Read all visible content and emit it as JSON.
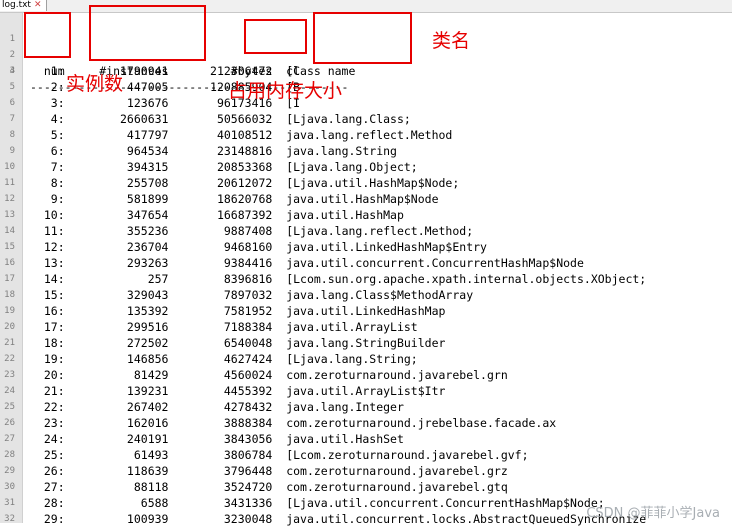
{
  "tab": {
    "filename": "log.txt",
    "close_glyph": "✕"
  },
  "header": {
    "text": "  num     #instances         #bytes  class name"
  },
  "separator": {
    "text": "----------------------------------------------"
  },
  "table": {
    "rows": [
      {
        "num": "1:",
        "instances": "1790941",
        "bytes": "212306472",
        "cls": "[C"
      },
      {
        "num": "2:",
        "instances": "447005",
        "bytes": "120885904",
        "cls": "[B"
      },
      {
        "num": "3:",
        "instances": "123676",
        "bytes": "96173416",
        "cls": "[I"
      },
      {
        "num": "4:",
        "instances": "2660631",
        "bytes": "50566032",
        "cls": "[Ljava.lang.Class;"
      },
      {
        "num": "5:",
        "instances": "417797",
        "bytes": "40108512",
        "cls": "java.lang.reflect.Method"
      },
      {
        "num": "6:",
        "instances": "964534",
        "bytes": "23148816",
        "cls": "java.lang.String"
      },
      {
        "num": "7:",
        "instances": "394315",
        "bytes": "20853368",
        "cls": "[Ljava.lang.Object;"
      },
      {
        "num": "8:",
        "instances": "255708",
        "bytes": "20612072",
        "cls": "[Ljava.util.HashMap$Node;"
      },
      {
        "num": "9:",
        "instances": "581899",
        "bytes": "18620768",
        "cls": "java.util.HashMap$Node"
      },
      {
        "num": "10:",
        "instances": "347654",
        "bytes": "16687392",
        "cls": "java.util.HashMap"
      },
      {
        "num": "11:",
        "instances": "355236",
        "bytes": "9887408",
        "cls": "[Ljava.lang.reflect.Method;"
      },
      {
        "num": "12:",
        "instances": "236704",
        "bytes": "9468160",
        "cls": "java.util.LinkedHashMap$Entry"
      },
      {
        "num": "13:",
        "instances": "293263",
        "bytes": "9384416",
        "cls": "java.util.concurrent.ConcurrentHashMap$Node"
      },
      {
        "num": "14:",
        "instances": "257",
        "bytes": "8396816",
        "cls": "[Lcom.sun.org.apache.xpath.internal.objects.XObject;"
      },
      {
        "num": "15:",
        "instances": "329043",
        "bytes": "7897032",
        "cls": "java.lang.Class$MethodArray"
      },
      {
        "num": "16:",
        "instances": "135392",
        "bytes": "7581952",
        "cls": "java.util.LinkedHashMap"
      },
      {
        "num": "17:",
        "instances": "299516",
        "bytes": "7188384",
        "cls": "java.util.ArrayList"
      },
      {
        "num": "18:",
        "instances": "272502",
        "bytes": "6540048",
        "cls": "java.lang.StringBuilder"
      },
      {
        "num": "19:",
        "instances": "146856",
        "bytes": "4627424",
        "cls": "[Ljava.lang.String;"
      },
      {
        "num": "20:",
        "instances": "81429",
        "bytes": "4560024",
        "cls": "com.zeroturnaround.javarebel.grn"
      },
      {
        "num": "21:",
        "instances": "139231",
        "bytes": "4455392",
        "cls": "java.util.ArrayList$Itr"
      },
      {
        "num": "22:",
        "instances": "267402",
        "bytes": "4278432",
        "cls": "java.lang.Integer"
      },
      {
        "num": "23:",
        "instances": "162016",
        "bytes": "3888384",
        "cls": "com.zeroturnaround.jrebelbase.facade.ax"
      },
      {
        "num": "24:",
        "instances": "240191",
        "bytes": "3843056",
        "cls": "java.util.HashSet"
      },
      {
        "num": "25:",
        "instances": "61493",
        "bytes": "3806784",
        "cls": "[Lcom.zeroturnaround.javarebel.gvf;"
      },
      {
        "num": "26:",
        "instances": "118639",
        "bytes": "3796448",
        "cls": "com.zeroturnaround.javarebel.grz"
      },
      {
        "num": "27:",
        "instances": "88118",
        "bytes": "3524720",
        "cls": "com.zeroturnaround.javarebel.gtq"
      },
      {
        "num": "28:",
        "instances": "6588",
        "bytes": "3431336",
        "cls": "[Ljava.util.concurrent.ConcurrentHashMap$Node;"
      },
      {
        "num": "29:",
        "instances": "100939",
        "bytes": "3230048",
        "cls": "java.util.concurrent.locks.AbstractQueuedSynchronize"
      }
    ]
  },
  "annotations": {
    "class_name": "类名",
    "instance_count": "实例数",
    "memory_size": "占用内存大小"
  },
  "watermark": "CSDN @菲菲小学Java",
  "colors": {
    "highlight": "#e60000",
    "gutter": "#e4e4e4",
    "line_number": "#808080"
  }
}
